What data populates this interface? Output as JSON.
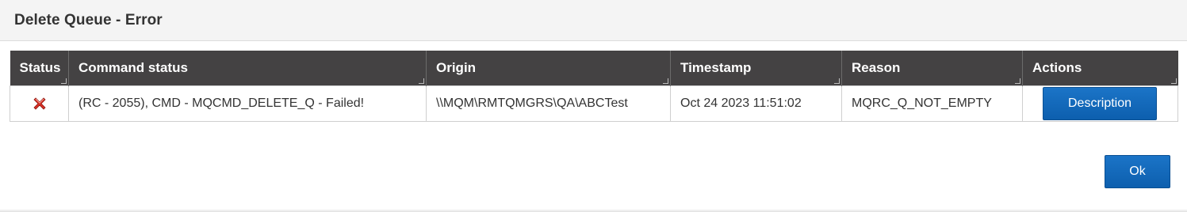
{
  "dialog": {
    "title": "Delete Queue - Error"
  },
  "table": {
    "headers": {
      "status": "Status",
      "command_status": "Command status",
      "origin": "Origin",
      "timestamp": "Timestamp",
      "reason": "Reason",
      "actions": "Actions"
    },
    "rows": [
      {
        "status_icon": "error-x-icon",
        "command_status": "(RC - 2055), CMD - MQCMD_DELETE_Q - Failed!",
        "origin": "\\\\MQM\\RMTQMGRS\\QA\\ABCTest",
        "timestamp": "Oct 24 2023 11:51:02",
        "reason": "MQRC_Q_NOT_EMPTY",
        "action_label": "Description"
      }
    ]
  },
  "buttons": {
    "ok_label": "Ok"
  },
  "colors": {
    "header_bg": "#444243",
    "button_blue": "#0d5fae",
    "error_red": "#d93025"
  }
}
